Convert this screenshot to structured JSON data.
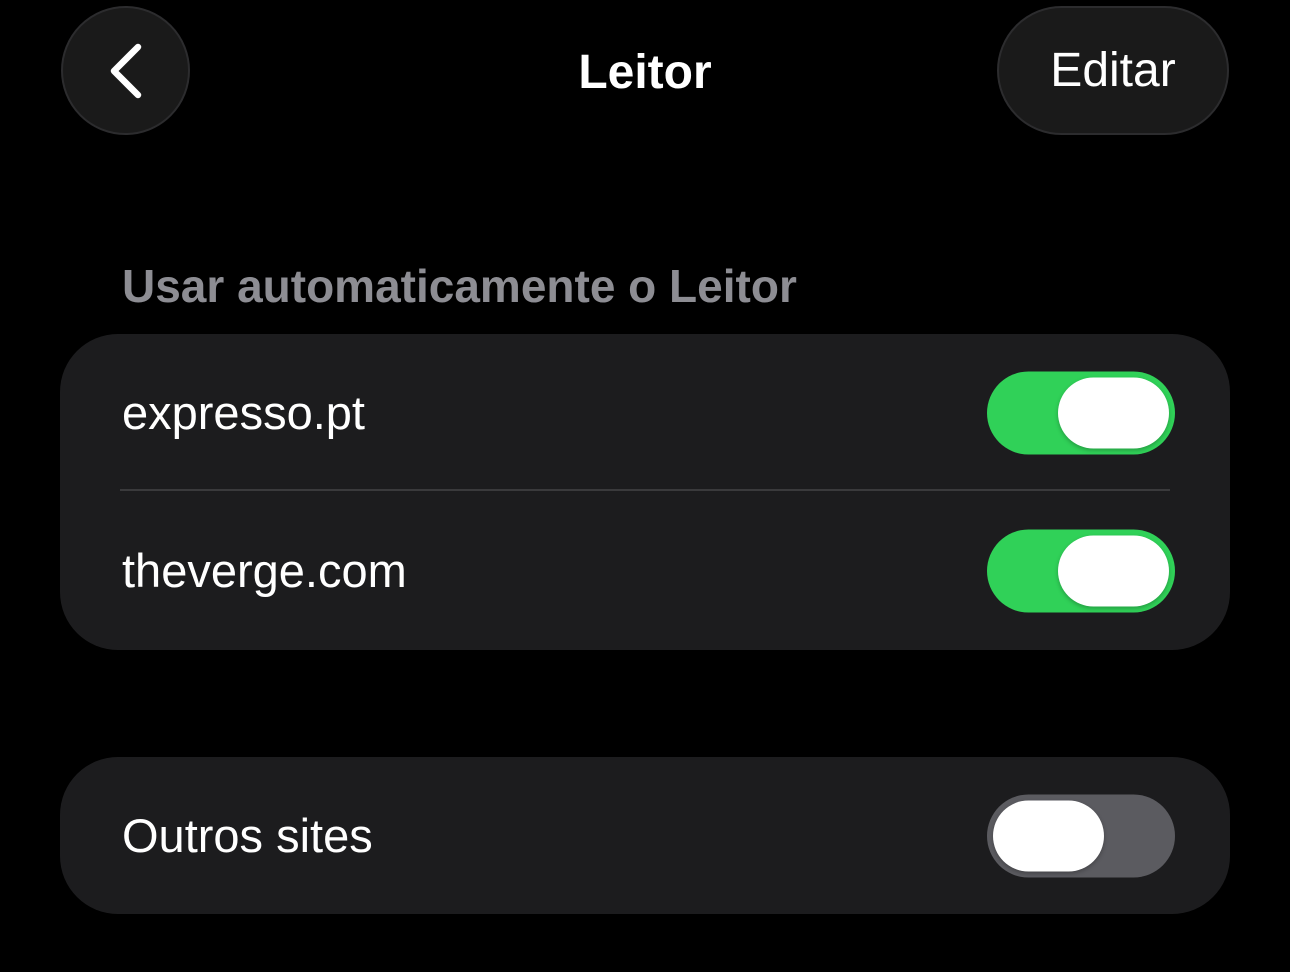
{
  "nav": {
    "back_icon": "chevron-left-icon",
    "title": "Leitor",
    "edit_label": "Editar"
  },
  "section": {
    "header": "Usar automaticamente o Leitor",
    "sites": [
      {
        "label": "expresso.pt",
        "enabled": true
      },
      {
        "label": "theverge.com",
        "enabled": true
      }
    ]
  },
  "other": {
    "label": "Outros sites",
    "enabled": false
  },
  "colors": {
    "background": "#000000",
    "group_background": "#1c1c1e",
    "toggle_on": "#30d158",
    "toggle_off": "#5b5b60",
    "header_text": "#8d8d93"
  }
}
